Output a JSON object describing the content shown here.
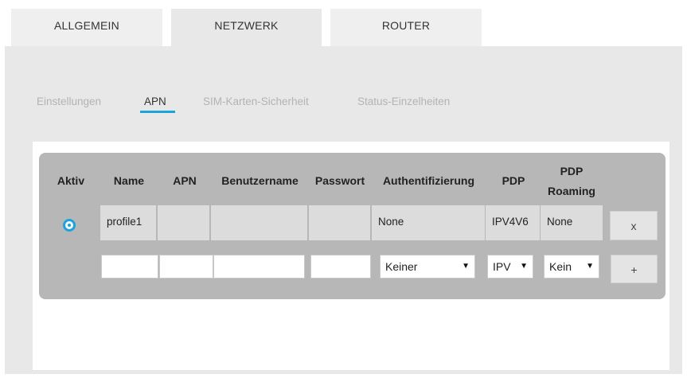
{
  "top_tabs": [
    {
      "label": "ALLGEMEIN"
    },
    {
      "label": "NETZWERK"
    },
    {
      "label": "ROUTER"
    }
  ],
  "sub_tabs": [
    {
      "label": "Einstellungen"
    },
    {
      "label": "APN"
    },
    {
      "label": "SIM-Karten-Sicherheit"
    },
    {
      "label": "Status-Einzelheiten"
    }
  ],
  "active_sub_tab": "APN",
  "table": {
    "headers": {
      "aktiv": "Aktiv",
      "name": "Name",
      "apn": "APN",
      "benutzername": "Benutzername",
      "passwort": "Passwort",
      "auth": "Authentifizierung",
      "pdp": "PDP",
      "pdp_roaming_1": "PDP",
      "pdp_roaming_2": "Roaming"
    },
    "row": {
      "name": "profile1",
      "apn": "",
      "benutzername": "",
      "passwort": "",
      "auth": "None",
      "pdp": "IPV4V6",
      "pdp_roaming": "None",
      "delete_label": "x"
    },
    "new_row": {
      "auth_select": "Keiner",
      "pdp_select": "IPV",
      "roaming_select": "Kein",
      "add_label": "+"
    }
  },
  "colors": {
    "accent": "#1aa3dc",
    "panel": "#e8e8e8",
    "grid": "#b7b7b7",
    "cell": "#dcdcdc"
  }
}
